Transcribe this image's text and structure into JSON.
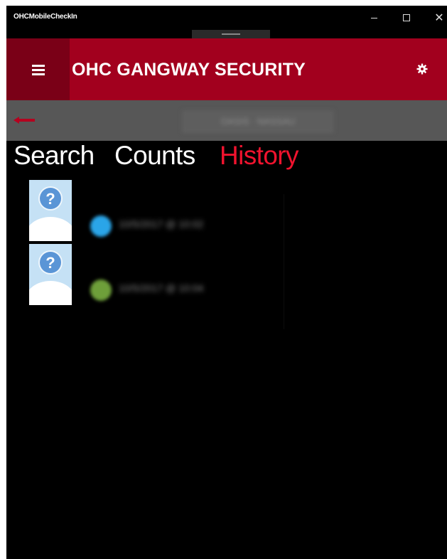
{
  "window": {
    "title": "OHCMobileCheckIn",
    "controls": {
      "minimize": "minimize",
      "maximize": "maximize",
      "close": "✕"
    }
  },
  "header": {
    "title": "OHC GANGWAY SECURITY",
    "menu_icon": "hamburger-menu-icon",
    "settings_icon": "gear-icon"
  },
  "subbar": {
    "back_icon": "back-arrow-icon",
    "ship_field_value": "OASIS · NASSAU",
    "accent_color": "#a2001e"
  },
  "tabs": [
    {
      "label": "Search",
      "active": false
    },
    {
      "label": "Counts",
      "active": false
    },
    {
      "label": "History",
      "active": true
    }
  ],
  "history": [
    {
      "avatar_icon": "unknown-person-icon",
      "status_color": "#2aa5e8",
      "text": "10/5/2017 @ 10:02"
    },
    {
      "avatar_icon": "unknown-person-icon",
      "status_color": "#6e9f3a",
      "text": "10/5/2017 @ 10:04"
    }
  ],
  "colors": {
    "header_bg": "#a2001e",
    "menu_bg": "#7a0017",
    "active_tab": "#f0132e",
    "subbar_bg": "#575757"
  }
}
